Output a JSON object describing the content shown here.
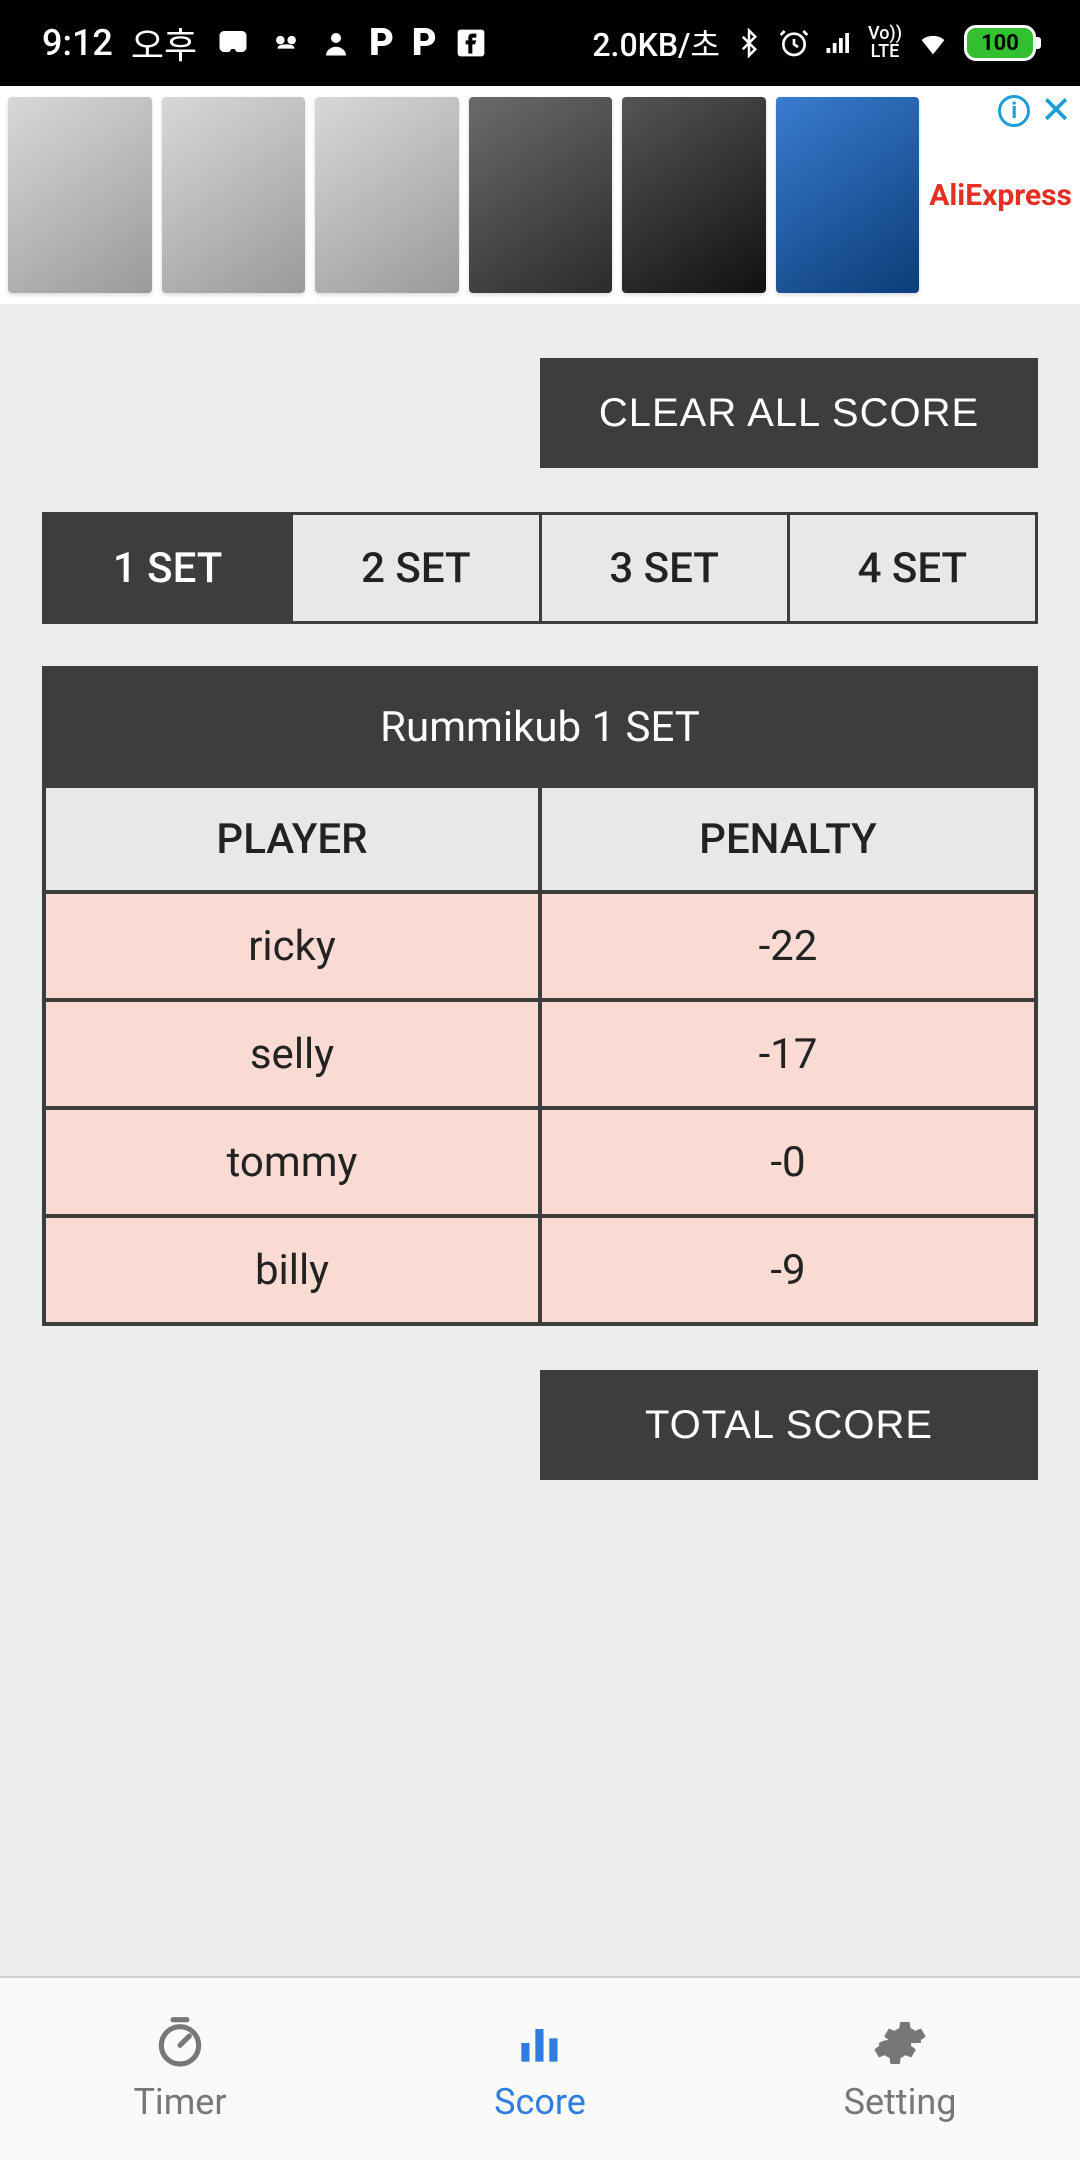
{
  "statusbar": {
    "time": "9:12",
    "meridiem": "오후",
    "data_rate": "2.0KB/초",
    "battery": "100"
  },
  "ad": {
    "brand": "AliExpress"
  },
  "buttons": {
    "clear_all": "CLEAR ALL SCORE",
    "total_score": "TOTAL SCORE"
  },
  "tabs": [
    {
      "label": "1 SET",
      "active": true
    },
    {
      "label": "2 SET",
      "active": false
    },
    {
      "label": "3 SET",
      "active": false
    },
    {
      "label": "4 SET",
      "active": false
    }
  ],
  "table": {
    "title": "Rummikub 1 SET",
    "headers": {
      "player": "PLAYER",
      "penalty": "PENALTY"
    },
    "rows": [
      {
        "player": "ricky",
        "penalty": "-22"
      },
      {
        "player": "selly",
        "penalty": "-17"
      },
      {
        "player": "tommy",
        "penalty": "-0"
      },
      {
        "player": "billy",
        "penalty": "-9"
      }
    ]
  },
  "nav": {
    "timer": "Timer",
    "score": "Score",
    "setting": "Setting"
  }
}
